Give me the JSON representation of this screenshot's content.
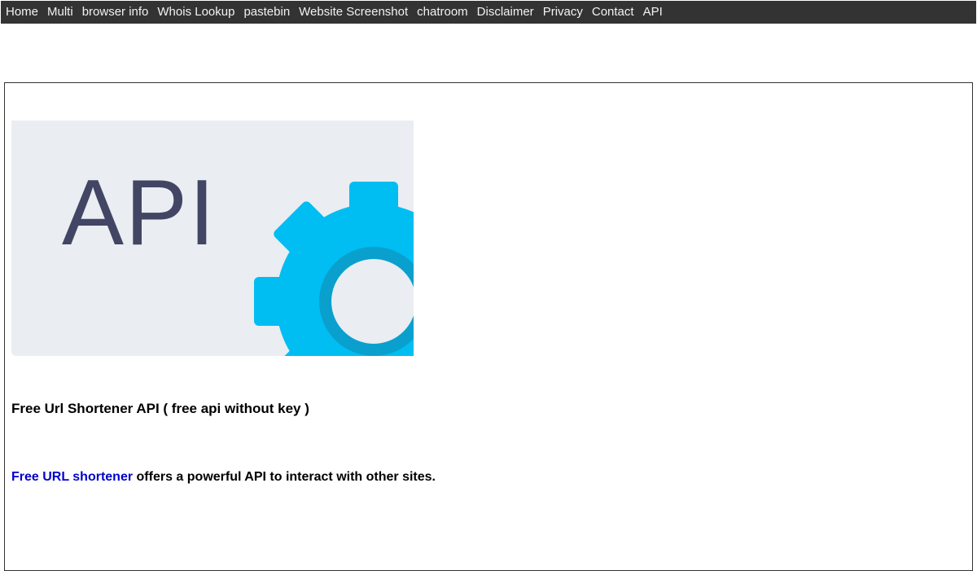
{
  "nav": {
    "items": [
      {
        "label": "Home"
      },
      {
        "label": "Multi"
      },
      {
        "label": "browser info"
      },
      {
        "label": "Whois Lookup"
      },
      {
        "label": "pastebin"
      },
      {
        "label": "Website Screenshot"
      },
      {
        "label": "chatroom"
      },
      {
        "label": "Disclaimer"
      },
      {
        "label": "Privacy"
      },
      {
        "label": "Contact"
      },
      {
        "label": "API"
      }
    ]
  },
  "main": {
    "banner": {
      "text": "API",
      "icon": "gear-icon",
      "colors": {
        "background": "#eaedf2",
        "text": "#424563",
        "gear": "#00bdf2",
        "gear_ring": "#0aa0cd"
      }
    },
    "heading": "Free Url Shortener API ( free api without key )",
    "intro": {
      "link_text": "Free URL shortener",
      "rest_text": " offers a powerful API to interact with other sites."
    }
  },
  "colors": {
    "nav_background": "#333333",
    "nav_text": "#f2f2f2",
    "link": "#0000cc"
  }
}
